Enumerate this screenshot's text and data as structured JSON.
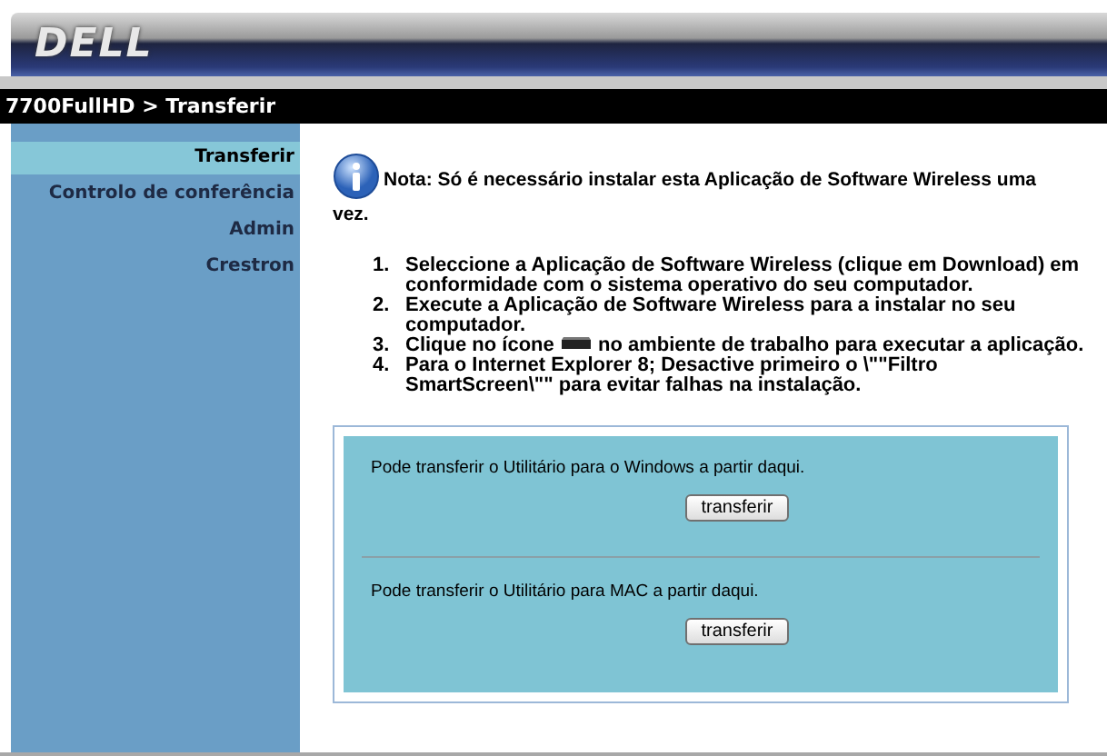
{
  "header": {
    "logo": "DELL"
  },
  "breadcrumb": "7700FullHD > Transferir",
  "sidebar": {
    "items": [
      {
        "label": "Transferir",
        "selected": true
      },
      {
        "label": "Controlo de conferência",
        "selected": false
      },
      {
        "label": "Admin",
        "selected": false
      },
      {
        "label": "Crestron",
        "selected": false
      }
    ]
  },
  "note": "Nota: Só é necessário instalar esta Aplicação de Software Wireless uma vez.",
  "steps": [
    {
      "number": "1.",
      "text": "Seleccione a Aplicação de Software Wireless (clique em Download) em conformidade com o sistema operativo do seu computador."
    },
    {
      "number": "2.",
      "text": "Execute a Aplicação de Software Wireless para a instalar no seu computador."
    },
    {
      "number": "3.",
      "kind": "icon",
      "text": "Clique no ícone",
      "text_after": "no ambiente de trabalho para executar a aplicação."
    },
    {
      "number": "4.",
      "text": "Para o Internet Explorer 8; Desactive primeiro o \\\"\"Filtro SmartScreen\\\"\" para evitar falhas na instalação."
    }
  ],
  "downloads": [
    {
      "text": "Pode transferir o Utilitário para o Windows a partir daqui.",
      "button": "transferir"
    },
    {
      "text": "Pode transferir o Utilitário para MAC a partir daqui.",
      "button": "transferir"
    }
  ]
}
